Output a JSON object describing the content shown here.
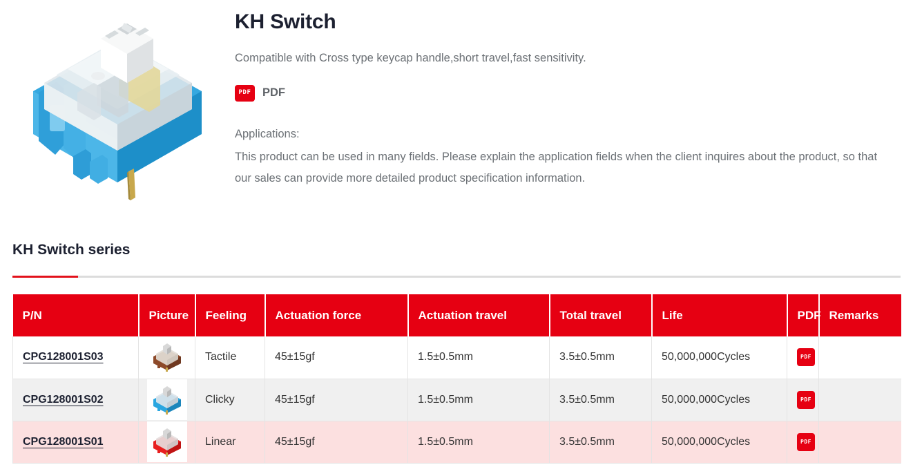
{
  "product": {
    "title": "KH Switch",
    "subtitle": "Compatible with Cross type keycap handle,short travel,fast sensitivity.",
    "pdf_label": "PDF",
    "pdf_icon_text": "PDF",
    "applications_heading": "Applications:",
    "applications_text": "This product can be used in many fields. Please explain the application fields when the client inquires about the product, so that our sales can provide more detailed product specification information.",
    "image_alt": "kh-switch-product-photo"
  },
  "section": {
    "title": "KH Switch series",
    "accent_color": "#e2111b",
    "rule_color": "#dcdcdc"
  },
  "table": {
    "header_bg": "#e60012",
    "headers": [
      "P/N",
      "Picture",
      "Feeling",
      "Actuation force",
      "Actuation travel",
      "Total travel",
      "Life",
      "PDF",
      "Remarks"
    ],
    "rows": [
      {
        "pn": "CPG128001S03",
        "switch_color": "#8d4a2a",
        "feeling": "Tactile",
        "actuation_force": "45±15gf",
        "actuation_travel": "1.5±0.5mm",
        "total_travel": "3.5±0.5mm",
        "life": "50,000,000Cycles",
        "pdf_icon_text": "PDF",
        "remarks": ""
      },
      {
        "pn": "CPG128001S02",
        "switch_color": "#2aa6e0",
        "feeling": "Clicky",
        "actuation_force": "45±15gf",
        "actuation_travel": "1.5±0.5mm",
        "total_travel": "3.5±0.5mm",
        "life": "50,000,000Cycles",
        "pdf_icon_text": "PDF",
        "remarks": ""
      },
      {
        "pn": "CPG128001S01",
        "switch_color": "#e81f1f",
        "feeling": "Linear",
        "actuation_force": "45±15gf",
        "actuation_travel": "1.5±0.5mm",
        "total_travel": "3.5±0.5mm",
        "life": "50,000,000Cycles",
        "pdf_icon_text": "PDF",
        "remarks": ""
      }
    ]
  }
}
